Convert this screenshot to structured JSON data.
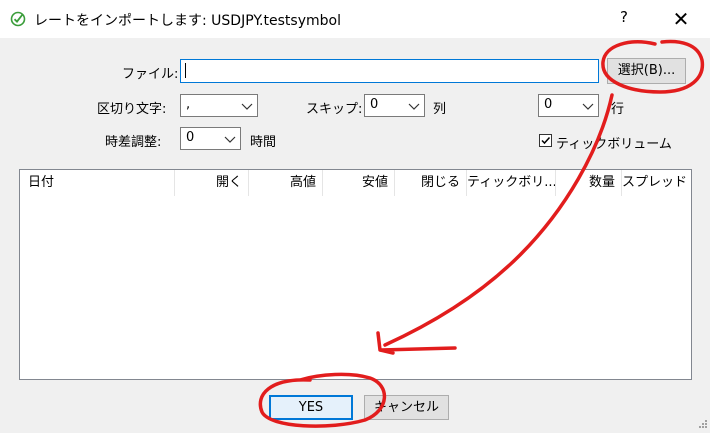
{
  "window": {
    "title": "レートをインポートします: USDJPY.testsymbol",
    "help_label": "?",
    "close_label": "✕"
  },
  "form": {
    "file_label": "ファイル:",
    "file_value": "",
    "browse_label": "選択(B)...",
    "delimiter_label": "区切り文字:",
    "delimiter_value": ",",
    "skip_label": "スキップ:",
    "skip_value": "0",
    "column_label": "列",
    "row_skip_value": "0",
    "row_label": "行",
    "timeshift_label": "時差調整:",
    "timeshift_value": "0",
    "hours_label": "時間",
    "tick_volume_label": "ティックボリューム",
    "tick_volume_checked": true
  },
  "table": {
    "columns": [
      "日付",
      "開く",
      "高値",
      "安値",
      "閉じる",
      "ティックボリ...",
      "数量",
      "スプレッド"
    ],
    "rows": []
  },
  "buttons": {
    "yes_label": "YES",
    "cancel_label": "キャンセル"
  },
  "colors": {
    "accent": "#0078d7",
    "annotation": "#e21d1d"
  }
}
